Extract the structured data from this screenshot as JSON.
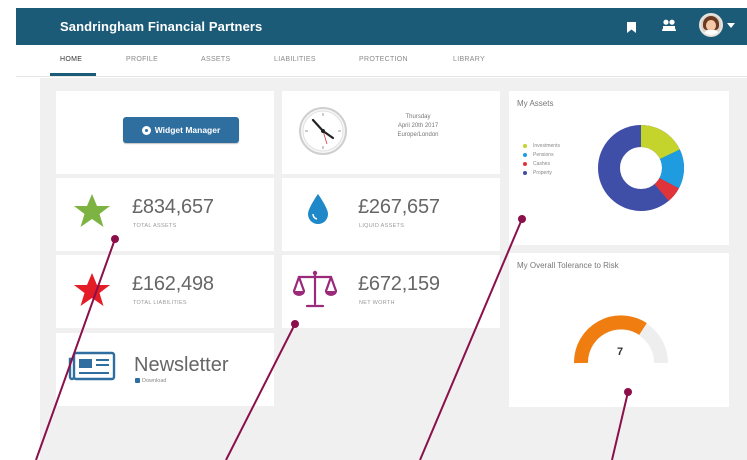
{
  "header": {
    "brand": "Sandringham Financial Partners",
    "icons": [
      "bookmark-icon",
      "users-icon",
      "avatar"
    ]
  },
  "tabs": [
    {
      "label": "HOME",
      "active": true
    },
    {
      "label": "PROFILE"
    },
    {
      "label": "ASSETS"
    },
    {
      "label": "LIABILITIES"
    },
    {
      "label": "PROTECTION"
    },
    {
      "label": "LIBRARY"
    }
  ],
  "widget_manager": {
    "label": "Widget Manager"
  },
  "date_card": {
    "day": "Thursday",
    "date": "April 20th 2017",
    "location": "Europe/London"
  },
  "stats": {
    "total_assets": {
      "value": "£834,657",
      "label": "TOTAL ASSETS",
      "icon": "star-icon",
      "color": "#7cb342"
    },
    "liquid_assets": {
      "value": "£267,657",
      "label": "LIQUID ASSETS",
      "icon": "water-drop-icon",
      "color": "#1e88c8"
    },
    "total_liabilities": {
      "value": "£162,498",
      "label": "TOTAL LIABILITIES",
      "icon": "star-icon",
      "color": "#e31c25"
    },
    "net_worth": {
      "value": "£672,159",
      "label": "NET WORTH",
      "icon": "scales-icon",
      "color": "#9b2a7a"
    }
  },
  "newsletter": {
    "title": "Newsletter",
    "sub": "Download"
  },
  "my_assets": {
    "title": "My Assets",
    "legend": [
      {
        "name": "Investments",
        "color": "#c5d42c"
      },
      {
        "name": "Pensions",
        "color": "#1f9be0"
      },
      {
        "name": "Cashes",
        "color": "#e0343a"
      },
      {
        "name": "Property",
        "color": "#3f4fa8"
      }
    ]
  },
  "risk": {
    "title": "My Overall Tolerance to Risk",
    "value": "7",
    "fill_fraction": 0.7,
    "fill_color": "#f07d10"
  },
  "colors": {
    "header": "#1c5b78",
    "button": "#2f6fa0",
    "callout": "#8b0f4a"
  }
}
